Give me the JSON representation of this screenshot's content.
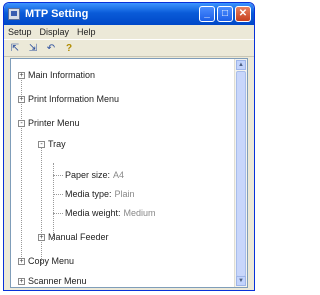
{
  "window": {
    "title": "MTP Setting",
    "icon": "app-icon",
    "controls": [
      "minimize",
      "maximize",
      "close"
    ]
  },
  "menubar": {
    "items": [
      "Setup",
      "Display",
      "Help"
    ]
  },
  "toolbar": {
    "icons": [
      "open-icon",
      "save-icon",
      "undo-icon",
      "help-icon"
    ]
  },
  "tree": {
    "items": [
      {
        "label": "Main Information",
        "expander": "+"
      },
      {
        "label": "Print Information Menu",
        "expander": "+"
      },
      {
        "label": "Printer Menu",
        "expander": "-"
      },
      {
        "label": "Tray",
        "expander": "-"
      },
      {
        "label": "Paper size:",
        "value": "A4"
      },
      {
        "label": "Media type:",
        "value": "Plain"
      },
      {
        "label": "Media weight:",
        "value": "Medium"
      },
      {
        "label": "Manual Feeder",
        "expander": "+"
      },
      {
        "label": "Copy Menu",
        "expander": "+"
      },
      {
        "label": "Scanner Menu",
        "expander": "+"
      }
    ]
  }
}
